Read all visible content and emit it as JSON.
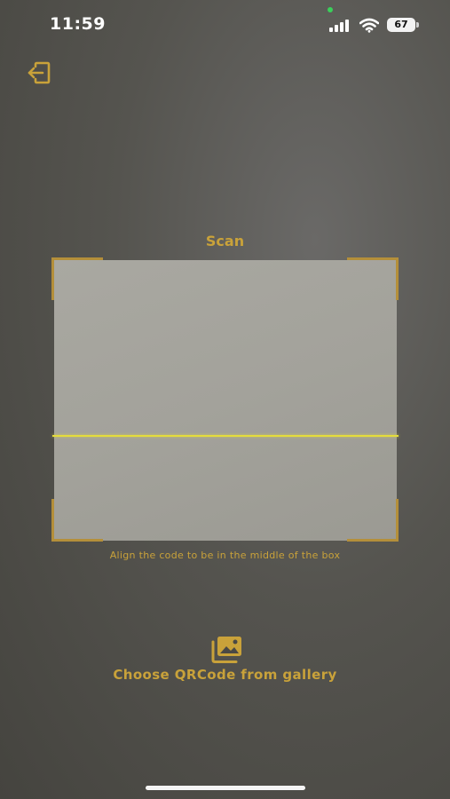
{
  "status_bar": {
    "time": "11:59",
    "battery_level": "67",
    "icons": [
      "signal-icon",
      "wifi-icon",
      "battery-icon"
    ]
  },
  "header": {
    "back_icon": "exit-icon"
  },
  "scanner": {
    "title": "Scan",
    "hint": "Align the code to be in the middle of the box",
    "accent_color": "#c9a23a",
    "scan_line_color": "#e4dc3c"
  },
  "gallery": {
    "icon": "photo-gallery-icon",
    "label": "Choose QRCode from gallery"
  }
}
